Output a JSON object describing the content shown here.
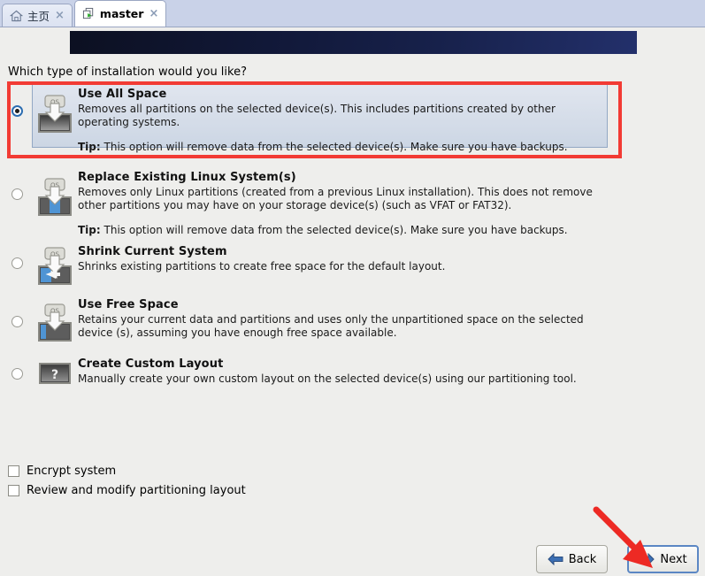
{
  "window": {
    "tabs": [
      {
        "label": "主页",
        "icon": "home-icon",
        "close": "×",
        "active": false
      },
      {
        "label": "master",
        "icon": "vm-console-icon",
        "close": "×",
        "active": true
      }
    ]
  },
  "main": {
    "question": "Which type of installation would you like?",
    "options": [
      {
        "title": "Use All Space",
        "desc": "Removes all partitions on the selected device(s).  This includes partitions created by other operating systems.",
        "tip_label": "Tip:",
        "tip": "This option will remove data from the selected device(s).  Make sure you have backups.",
        "selected": true,
        "icon": "disk-all-space-icon"
      },
      {
        "title": "Replace Existing Linux System(s)",
        "desc": "Removes only Linux partitions (created from a previous Linux installation).  This does not remove other partitions you may have on your storage device(s) (such as VFAT or FAT32).",
        "tip_label": "Tip:",
        "tip": "This option will remove data from the selected device(s).  Make sure you have backups.",
        "selected": false,
        "icon": "disk-replace-linux-icon"
      },
      {
        "title": "Shrink Current System",
        "desc": "Shrinks existing partitions to create free space for the default layout.",
        "tip_label": "",
        "tip": "",
        "selected": false,
        "icon": "disk-shrink-icon"
      },
      {
        "title": "Use Free Space",
        "desc": "Retains your current data and partitions and uses only the unpartitioned space on the selected device (s), assuming you have enough free space available.",
        "tip_label": "",
        "tip": "",
        "selected": false,
        "icon": "disk-free-space-icon"
      },
      {
        "title": "Create Custom Layout",
        "desc": "Manually create your own custom layout on the selected device(s) using our partitioning tool.",
        "tip_label": "",
        "tip": "",
        "selected": false,
        "icon": "disk-custom-icon"
      }
    ],
    "checkboxes": [
      {
        "label": "Encrypt system",
        "checked": false
      },
      {
        "label": "Review and modify partitioning layout",
        "checked": false
      }
    ]
  },
  "footer": {
    "back_label": "Back",
    "next_label": "Next"
  },
  "annotations": {
    "highlight_color": "#f23b34",
    "arrow_color": "#ed2a24",
    "focus_color": "#5b87c4",
    "selected_panel_color": "#ccd6e4"
  }
}
